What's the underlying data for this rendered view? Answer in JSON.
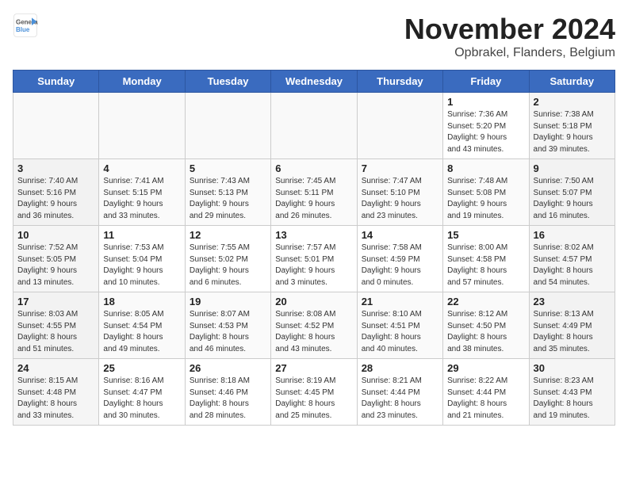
{
  "header": {
    "logo_line1": "General",
    "logo_line2": "Blue",
    "month": "November 2024",
    "location": "Opbrakel, Flanders, Belgium"
  },
  "weekdays": [
    "Sunday",
    "Monday",
    "Tuesday",
    "Wednesday",
    "Thursday",
    "Friday",
    "Saturday"
  ],
  "weeks": [
    [
      {
        "day": "",
        "info": ""
      },
      {
        "day": "",
        "info": ""
      },
      {
        "day": "",
        "info": ""
      },
      {
        "day": "",
        "info": ""
      },
      {
        "day": "",
        "info": ""
      },
      {
        "day": "1",
        "info": "Sunrise: 7:36 AM\nSunset: 5:20 PM\nDaylight: 9 hours\nand 43 minutes."
      },
      {
        "day": "2",
        "info": "Sunrise: 7:38 AM\nSunset: 5:18 PM\nDaylight: 9 hours\nand 39 minutes."
      }
    ],
    [
      {
        "day": "3",
        "info": "Sunrise: 7:40 AM\nSunset: 5:16 PM\nDaylight: 9 hours\nand 36 minutes."
      },
      {
        "day": "4",
        "info": "Sunrise: 7:41 AM\nSunset: 5:15 PM\nDaylight: 9 hours\nand 33 minutes."
      },
      {
        "day": "5",
        "info": "Sunrise: 7:43 AM\nSunset: 5:13 PM\nDaylight: 9 hours\nand 29 minutes."
      },
      {
        "day": "6",
        "info": "Sunrise: 7:45 AM\nSunset: 5:11 PM\nDaylight: 9 hours\nand 26 minutes."
      },
      {
        "day": "7",
        "info": "Sunrise: 7:47 AM\nSunset: 5:10 PM\nDaylight: 9 hours\nand 23 minutes."
      },
      {
        "day": "8",
        "info": "Sunrise: 7:48 AM\nSunset: 5:08 PM\nDaylight: 9 hours\nand 19 minutes."
      },
      {
        "day": "9",
        "info": "Sunrise: 7:50 AM\nSunset: 5:07 PM\nDaylight: 9 hours\nand 16 minutes."
      }
    ],
    [
      {
        "day": "10",
        "info": "Sunrise: 7:52 AM\nSunset: 5:05 PM\nDaylight: 9 hours\nand 13 minutes."
      },
      {
        "day": "11",
        "info": "Sunrise: 7:53 AM\nSunset: 5:04 PM\nDaylight: 9 hours\nand 10 minutes."
      },
      {
        "day": "12",
        "info": "Sunrise: 7:55 AM\nSunset: 5:02 PM\nDaylight: 9 hours\nand 6 minutes."
      },
      {
        "day": "13",
        "info": "Sunrise: 7:57 AM\nSunset: 5:01 PM\nDaylight: 9 hours\nand 3 minutes."
      },
      {
        "day": "14",
        "info": "Sunrise: 7:58 AM\nSunset: 4:59 PM\nDaylight: 9 hours\nand 0 minutes."
      },
      {
        "day": "15",
        "info": "Sunrise: 8:00 AM\nSunset: 4:58 PM\nDaylight: 8 hours\nand 57 minutes."
      },
      {
        "day": "16",
        "info": "Sunrise: 8:02 AM\nSunset: 4:57 PM\nDaylight: 8 hours\nand 54 minutes."
      }
    ],
    [
      {
        "day": "17",
        "info": "Sunrise: 8:03 AM\nSunset: 4:55 PM\nDaylight: 8 hours\nand 51 minutes."
      },
      {
        "day": "18",
        "info": "Sunrise: 8:05 AM\nSunset: 4:54 PM\nDaylight: 8 hours\nand 49 minutes."
      },
      {
        "day": "19",
        "info": "Sunrise: 8:07 AM\nSunset: 4:53 PM\nDaylight: 8 hours\nand 46 minutes."
      },
      {
        "day": "20",
        "info": "Sunrise: 8:08 AM\nSunset: 4:52 PM\nDaylight: 8 hours\nand 43 minutes."
      },
      {
        "day": "21",
        "info": "Sunrise: 8:10 AM\nSunset: 4:51 PM\nDaylight: 8 hours\nand 40 minutes."
      },
      {
        "day": "22",
        "info": "Sunrise: 8:12 AM\nSunset: 4:50 PM\nDaylight: 8 hours\nand 38 minutes."
      },
      {
        "day": "23",
        "info": "Sunrise: 8:13 AM\nSunset: 4:49 PM\nDaylight: 8 hours\nand 35 minutes."
      }
    ],
    [
      {
        "day": "24",
        "info": "Sunrise: 8:15 AM\nSunset: 4:48 PM\nDaylight: 8 hours\nand 33 minutes."
      },
      {
        "day": "25",
        "info": "Sunrise: 8:16 AM\nSunset: 4:47 PM\nDaylight: 8 hours\nand 30 minutes."
      },
      {
        "day": "26",
        "info": "Sunrise: 8:18 AM\nSunset: 4:46 PM\nDaylight: 8 hours\nand 28 minutes."
      },
      {
        "day": "27",
        "info": "Sunrise: 8:19 AM\nSunset: 4:45 PM\nDaylight: 8 hours\nand 25 minutes."
      },
      {
        "day": "28",
        "info": "Sunrise: 8:21 AM\nSunset: 4:44 PM\nDaylight: 8 hours\nand 23 minutes."
      },
      {
        "day": "29",
        "info": "Sunrise: 8:22 AM\nSunset: 4:44 PM\nDaylight: 8 hours\nand 21 minutes."
      },
      {
        "day": "30",
        "info": "Sunrise: 8:23 AM\nSunset: 4:43 PM\nDaylight: 8 hours\nand 19 minutes."
      }
    ]
  ]
}
